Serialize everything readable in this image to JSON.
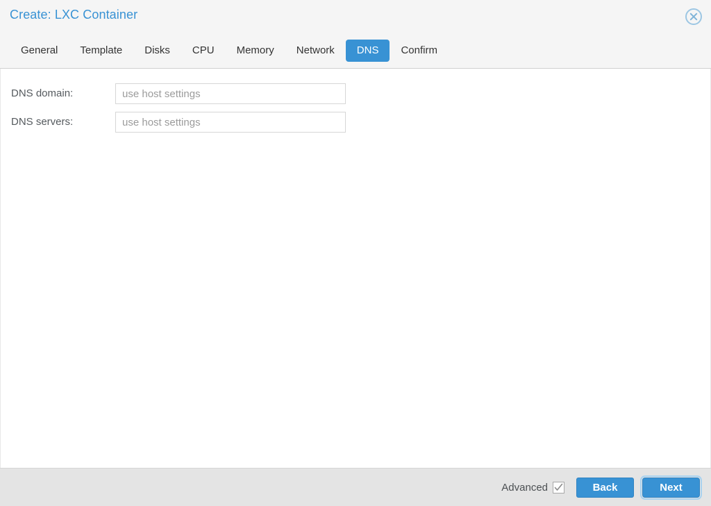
{
  "window": {
    "title": "Create: LXC Container",
    "close_icon": "close-circle-icon",
    "accent_color": "#3892d4",
    "title_color": "#3892d4",
    "header_bg": "#f5f5f5",
    "footer_bg": "#e4e4e4",
    "body_bg": "#ffffff"
  },
  "tabs": [
    {
      "label": "General",
      "active": false
    },
    {
      "label": "Template",
      "active": false
    },
    {
      "label": "Disks",
      "active": false
    },
    {
      "label": "CPU",
      "active": false
    },
    {
      "label": "Memory",
      "active": false
    },
    {
      "label": "Network",
      "active": false
    },
    {
      "label": "DNS",
      "active": true
    },
    {
      "label": "Confirm",
      "active": false
    }
  ],
  "form": {
    "fields": [
      {
        "label": "DNS domain:",
        "value": "",
        "placeholder": "use host settings"
      },
      {
        "label": "DNS servers:",
        "value": "",
        "placeholder": "use host settings"
      }
    ]
  },
  "footer": {
    "advanced_label": "Advanced",
    "advanced_checked": true,
    "advanced_check_icon": "checkmark-icon",
    "back_label": "Back",
    "next_label": "Next",
    "next_focused": true
  }
}
